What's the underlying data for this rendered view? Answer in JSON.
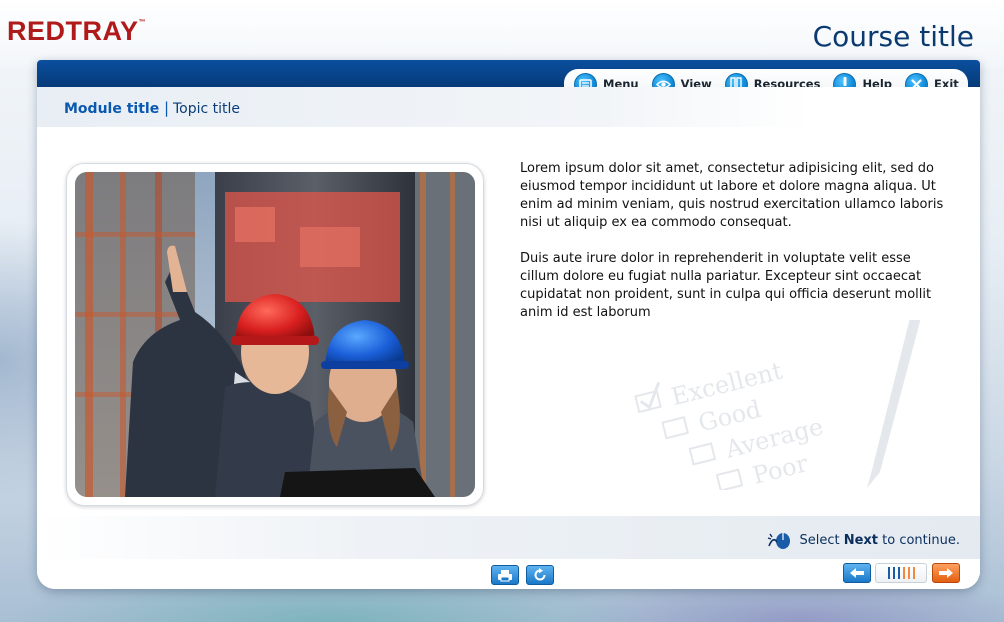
{
  "app": {
    "brand": "REDTRAY",
    "brand_mark": "™",
    "course_title": "Course title"
  },
  "menu": [
    {
      "id": "menu",
      "label": "Menu",
      "icon": "menu-icon"
    },
    {
      "id": "view",
      "label": "View",
      "icon": "eye-icon"
    },
    {
      "id": "resources",
      "label": "Resources",
      "icon": "book-icon"
    },
    {
      "id": "help",
      "label": "Help",
      "icon": "exclamation-icon"
    },
    {
      "id": "exit",
      "label": "Exit",
      "icon": "close-icon"
    }
  ],
  "breadcrumb": {
    "module": "Module title",
    "separator": "|",
    "topic": "Topic title"
  },
  "content": {
    "paragraphs": [
      "Lorem ipsum dolor sit amet, consectetur adipisicing elit, sed do eiusmod tempor incididunt ut labore et dolore magna aliqua. Ut enim ad minim veniam, quis nostrud exercitation ullamco laboris nisi ut aliquip ex ea commodo consequat.",
      "Duis aute irure dolor in reprehenderit in voluptate velit esse cillum dolore eu fugiat nulla pariatur. Excepteur sint occaecat cupidatat non proident, sunt in culpa qui officia deserunt mollit anim id est laborum"
    ],
    "image": {
      "icon": "photo-engineers-hardhats"
    },
    "watermark_words": [
      "Excellent",
      "Good",
      "Average",
      "Poor"
    ]
  },
  "instruction": {
    "prefix": "Select ",
    "bold": "Next",
    "suffix": " to continue.",
    "icon": "mouse-click-icon"
  },
  "footer": {
    "print_icon": "print-icon",
    "replay_icon": "replay-icon",
    "back_icon": "arrow-left-icon",
    "next_icon": "arrow-right-icon",
    "progress": {
      "completed": 3,
      "total": 6
    }
  },
  "colors": {
    "brand_red": "#b01a1a",
    "navy": "#0b3a70",
    "accent_blue": "#0a58b0",
    "next_orange": "#e35f10"
  }
}
